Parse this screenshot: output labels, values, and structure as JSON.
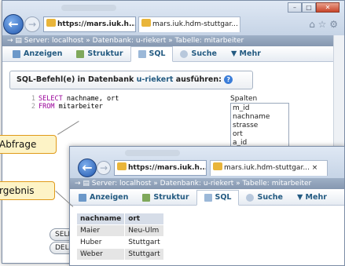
{
  "window_back": {
    "tab1_url": "https://mars.iuk.h...",
    "tab2_title": "mars.iuk.hdm-stuttgar...",
    "tab_close": "×",
    "controls": {
      "minimize": "–",
      "maximize": "□",
      "close": "✕"
    },
    "breadcrumb": "Server: localhost » Datenbank: u-riekert » Tabelle: mitarbeiter",
    "menu": [
      "Anzeigen",
      "Struktur",
      "SQL",
      "Suche",
      "▼ Mehr"
    ],
    "sql_legend_prefix": "SQL-Befehl(e) in Datenbank ",
    "sql_legend_db": "u-riekert",
    "sql_legend_suffix": " ausführen:",
    "help": "?",
    "editor_lines": [
      {
        "n": "1",
        "kw": "SELECT",
        "rest": " nachname, ort"
      },
      {
        "n": "2",
        "kw": "FROM",
        "rest": " mitarbeiter"
      }
    ],
    "columns_label": "Spalten",
    "columns": [
      "m_id",
      "nachname",
      "strasse",
      "ort",
      "a_id"
    ],
    "buttons": {
      "select": "SELEC",
      "delete": "DELET"
    }
  },
  "window_front": {
    "tab1_url": "https://mars.iuk.h...",
    "tab2_title": "mars.iuk.hdm-stuttgar...",
    "tab_close": "×",
    "breadcrumb": "Server: localhost » Datenbank: u-riekert » Tabelle: mitarbeiter",
    "menu": [
      "Anzeigen",
      "Struktur",
      "SQL",
      "Suche",
      "▼ Mehr"
    ],
    "result": {
      "headers": [
        "nachname",
        "ort"
      ],
      "rows": [
        [
          "Maier",
          "Neu-Ulm"
        ],
        [
          "Huber",
          "Stuttgart"
        ],
        [
          "Weber",
          "Stuttgart"
        ]
      ]
    }
  },
  "callouts": {
    "abfrage": "Abfrage",
    "ergebnis": "rgebnis"
  },
  "colors": {
    "accent": "#235a81",
    "callout_bg": "#fdf3c6",
    "callout_border": "#e09a1a"
  }
}
